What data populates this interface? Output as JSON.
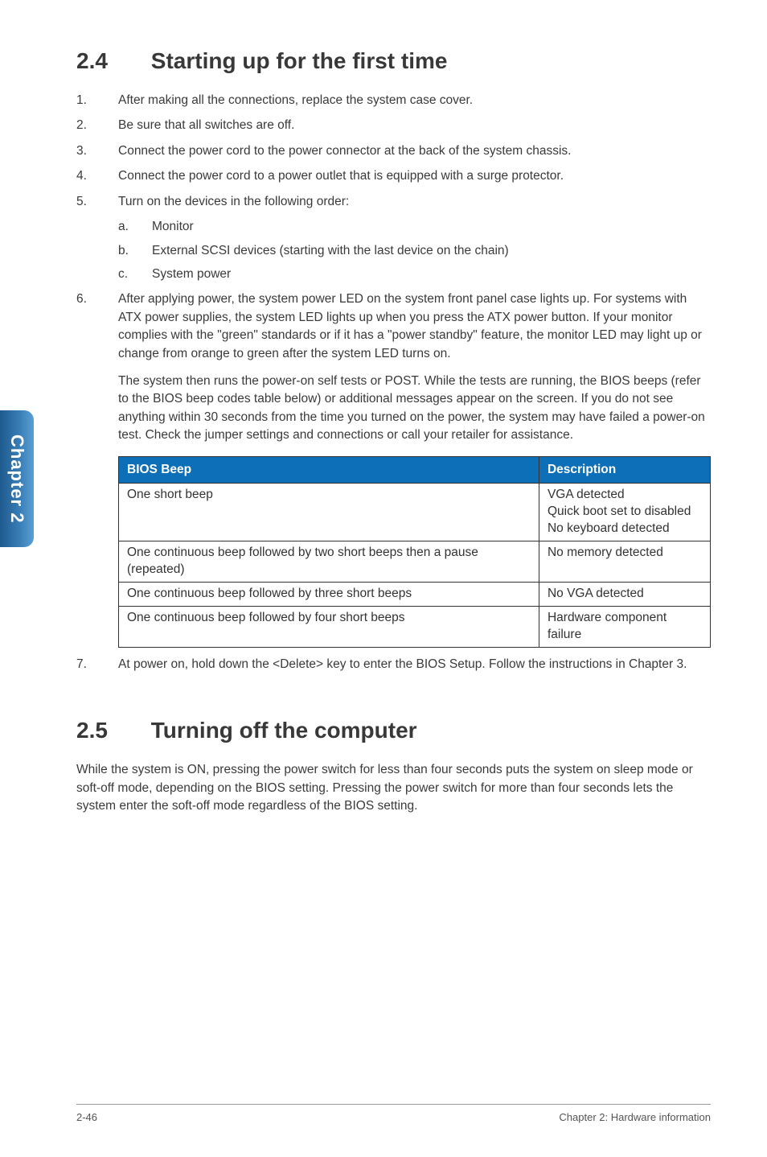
{
  "side_tab": "Chapter 2",
  "section1": {
    "number": "2.4",
    "title": "Starting up for the first time",
    "steps": [
      {
        "n": "1.",
        "text": "After making all the connections, replace the system case cover."
      },
      {
        "n": "2.",
        "text": "Be sure that all switches are off."
      },
      {
        "n": "3.",
        "text": "Connect the power cord to the power connector at the back of the system chassis."
      },
      {
        "n": "4.",
        "text": "Connect the power cord to a power outlet that is equipped with a surge protector."
      },
      {
        "n": "5.",
        "text": "Turn on the devices in the following order:",
        "sub": [
          {
            "m": "a.",
            "t": "Monitor"
          },
          {
            "m": "b.",
            "t": "External SCSI devices (starting with the last device on the chain)"
          },
          {
            "m": "c.",
            "t": "System power"
          }
        ]
      },
      {
        "n": "6.",
        "text": "After applying power, the system power LED on the system front panel case lights up. For systems with ATX power supplies, the system LED lights up when you press the ATX power button. If your monitor complies with the \"green\" standards or if it has a \"power standby\" feature, the monitor LED may light up or change from orange to green after the system LED turns on.",
        "para2": "The system then runs the power-on self tests or POST. While the tests are running, the BIOS beeps (refer to the BIOS beep codes table below) or additional messages appear on the screen. If you do not see anything within 30 seconds from the time you turned on the power, the system may have failed a power-on test. Check the jumper settings and connections or call your retailer for assistance."
      }
    ],
    "table": {
      "headers": [
        "BIOS Beep",
        "Description"
      ],
      "rows": [
        [
          "One short beep",
          "VGA detected\nQuick boot set to disabled\nNo keyboard detected"
        ],
        [
          "One continuous beep followed by two short beeps then a pause (repeated)",
          "No memory detected"
        ],
        [
          "One continuous beep followed by three short beeps",
          "No VGA detected"
        ],
        [
          "One continuous beep followed by four short beeps",
          "Hardware component failure"
        ]
      ]
    },
    "step7": {
      "n": "7.",
      "text": "At power on, hold down the <Delete> key to enter the BIOS Setup. Follow the instructions in Chapter 3."
    }
  },
  "section2": {
    "number": "2.5",
    "title": "Turning off the computer",
    "body": "While the system is ON, pressing the power switch for less than four seconds puts the system on sleep mode or soft-off mode, depending on the BIOS setting. Pressing the power switch for more than four seconds lets the system enter the soft-off mode regardless of the BIOS setting."
  },
  "footer": {
    "left": "2-46",
    "right": "Chapter 2: Hardware information"
  }
}
